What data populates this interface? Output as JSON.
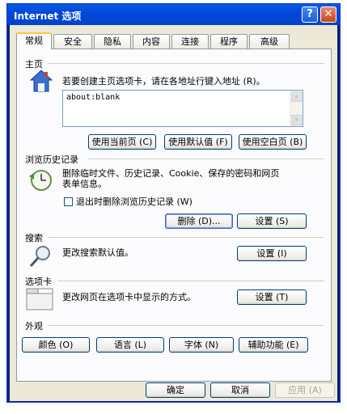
{
  "window": {
    "title": "Internet 选项"
  },
  "tabs": [
    "常规",
    "安全",
    "隐私",
    "内容",
    "连接",
    "程序",
    "高级"
  ],
  "home": {
    "heading": "主页",
    "desc": "若要创建主页选项卡，请在各地址行键入地址 (R)。",
    "value": "about:blank",
    "buttons": [
      "使用当前页 (C)",
      "使用默认值 (F)",
      "使用空白页 (B)"
    ]
  },
  "history": {
    "heading": "浏览历史记录",
    "desc_line1": "删除临时文件、历史记录、Cookie、保存的密码和网页",
    "desc_line2": "表单信息。",
    "checkbox": "退出时删除浏览历史记录 (W)",
    "delete_button": "删除 (D)...",
    "settings_button": "设置 (S)"
  },
  "search": {
    "heading": "搜索",
    "desc": "更改搜索默认值。",
    "settings_button": "设置 (I)"
  },
  "tabsgroup": {
    "heading": "选项卡",
    "desc": "更改网页在选项卡中显示的方式。",
    "settings_button": "设置 (T)"
  },
  "appearance": {
    "heading": "外观",
    "buttons": [
      "颜色 (O)",
      "语言 (L)",
      "字体 (N)",
      "辅助功能 (E)"
    ]
  },
  "footer": {
    "ok": "确定",
    "cancel": "取消",
    "apply": "应用 (A)"
  }
}
